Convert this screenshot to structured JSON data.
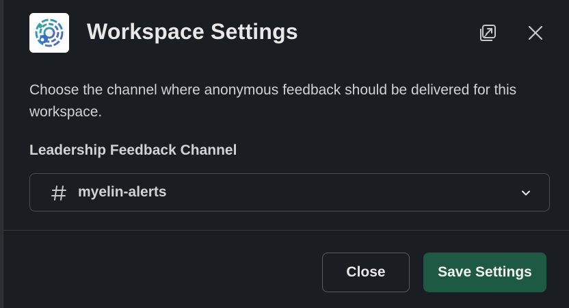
{
  "modal": {
    "title": "Workspace Settings",
    "description": "Choose the channel where anonymous feedback should be delivered for this workspace.",
    "field": {
      "label": "Leadership Feedback Channel",
      "selected_value": "myelin-alerts",
      "prefix_icon": "hash-icon",
      "dropdown_icon": "chevron-down-icon"
    },
    "header_icons": [
      "app-logo",
      "popout-icon",
      "close-icon"
    ],
    "buttons": {
      "close_label": "Close",
      "save_label": "Save Settings"
    }
  },
  "colors": {
    "background": "#1a1d21",
    "primary_button": "#1e5a43",
    "border": "#4a4c50",
    "text": "#d1d2d3"
  }
}
